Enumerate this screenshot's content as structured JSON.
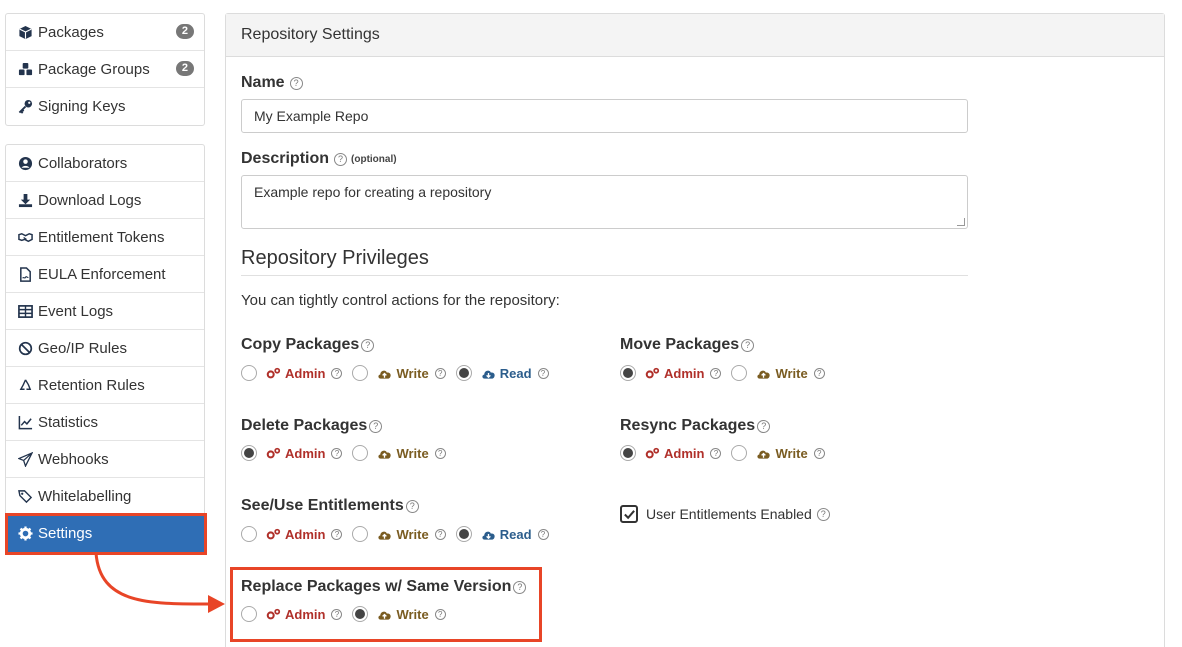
{
  "sidebar": {
    "group1": [
      {
        "label": "Packages",
        "icon": "cube-icon",
        "badge": "2"
      },
      {
        "label": "Package Groups",
        "icon": "cubes-icon",
        "badge": "2"
      },
      {
        "label": "Signing Keys",
        "icon": "key-icon"
      }
    ],
    "group2": [
      {
        "label": "Collaborators",
        "icon": "user-circle-icon"
      },
      {
        "label": "Download Logs",
        "icon": "download-icon"
      },
      {
        "label": "Entitlement Tokens",
        "icon": "handshake-icon"
      },
      {
        "label": "EULA Enforcement",
        "icon": "file-signature-icon"
      },
      {
        "label": "Event Logs",
        "icon": "table-icon"
      },
      {
        "label": "Geo/IP Rules",
        "icon": "ban-icon"
      },
      {
        "label": "Retention Rules",
        "icon": "recycle-icon"
      },
      {
        "label": "Statistics",
        "icon": "line-chart-icon"
      },
      {
        "label": "Webhooks",
        "icon": "paper-plane-icon"
      },
      {
        "label": "Whitelabelling",
        "icon": "tags-icon"
      },
      {
        "label": "Settings",
        "icon": "gear-icon",
        "active": true
      }
    ]
  },
  "panel": {
    "title": "Repository Settings",
    "name_label": "Name",
    "name_value": "My Example Repo",
    "description_label": "Description",
    "optional_label": "(optional)",
    "description_value": "Example repo for creating a repository",
    "privileges_title": "Repository Privileges",
    "privileges_intro": "You can tightly control actions for the repository:",
    "help_glyph": "?",
    "admin_label": "Admin",
    "write_label": "Write",
    "read_label": "Read",
    "copy_packages": {
      "label": "Copy Packages",
      "selected": "Read"
    },
    "move_packages": {
      "label": "Move Packages",
      "selected": "Admin"
    },
    "delete_packages": {
      "label": "Delete Packages",
      "selected": "Admin"
    },
    "resync_packages": {
      "label": "Resync Packages",
      "selected": "Admin"
    },
    "see_use_entitlements": {
      "label": "See/Use Entitlements",
      "selected": "Read"
    },
    "user_entitlements": {
      "label": "User Entitlements Enabled",
      "checked": true
    },
    "replace_packages": {
      "label": "Replace Packages w/ Same Version",
      "selected": "Write"
    }
  },
  "colors": {
    "highlight": "#e84527",
    "active_nav": "#2f6eb5",
    "admin": "#b0302a",
    "write": "#7a5c21",
    "read": "#2b5d8c"
  }
}
